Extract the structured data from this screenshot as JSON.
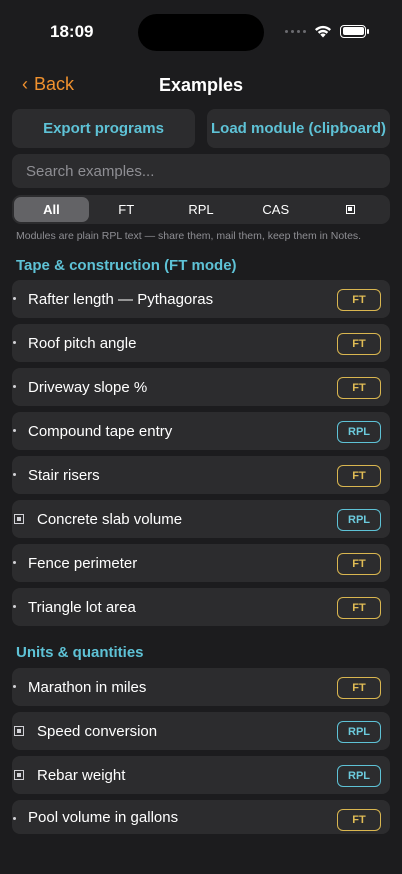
{
  "status": {
    "time": "18:09"
  },
  "nav": {
    "back_label": "Back",
    "title": "Examples"
  },
  "actions": {
    "export_label": "Export programs",
    "load_label": "Load module (clipboard)"
  },
  "search": {
    "placeholder": "Search examples..."
  },
  "filters": {
    "all": "All",
    "ft": "FT",
    "rpl": "RPL",
    "cas": "CAS",
    "program_icon": "stop-square-icon"
  },
  "hint": "Modules are plain RPL text — share them, mail them, keep them in Notes.",
  "sections": [
    {
      "title": "Tape & construction (FT mode)",
      "items": [
        {
          "label": "Rafter length — Pythagoras",
          "badge": "FT",
          "marker": "dot"
        },
        {
          "label": "Roof pitch angle",
          "badge": "FT",
          "marker": "dot"
        },
        {
          "label": "Driveway slope %",
          "badge": "FT",
          "marker": "dot"
        },
        {
          "label": "Compound tape entry",
          "badge": "RPL",
          "marker": "dot"
        },
        {
          "label": "Stair risers",
          "badge": "FT",
          "marker": "dot"
        },
        {
          "label": "Concrete slab volume",
          "badge": "RPL",
          "marker": "square"
        },
        {
          "label": "Fence perimeter",
          "badge": "FT",
          "marker": "dot"
        },
        {
          "label": "Triangle lot area",
          "badge": "FT",
          "marker": "dot"
        }
      ]
    },
    {
      "title": "Units & quantities",
      "items": [
        {
          "label": "Marathon in miles",
          "badge": "FT",
          "marker": "dot"
        },
        {
          "label": "Speed conversion",
          "badge": "RPL",
          "marker": "square"
        },
        {
          "label": "Rebar weight",
          "badge": "RPL",
          "marker": "square"
        },
        {
          "label": "Pool volume in gallons",
          "badge": "FT",
          "marker": "dot"
        }
      ]
    }
  ],
  "colors": {
    "accent_orange": "#f0912e",
    "accent_cyan": "#5ec2d6",
    "badge_ft": "#d9b650",
    "background": "#1c1c1e",
    "row": "#2c2c2e"
  }
}
